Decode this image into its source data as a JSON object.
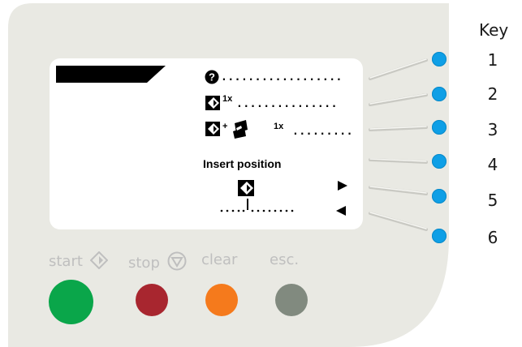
{
  "legend": {
    "title": "Key",
    "numbers": [
      "1",
      "2",
      "3",
      "4",
      "5",
      "6"
    ]
  },
  "display": {
    "multiplier_1": "1x",
    "multiplier_2": "1x",
    "insert_label": "Insert position"
  },
  "buttons": {
    "start_label": "start",
    "stop_label": "stop",
    "clear_label": "clear",
    "esc_label": "esc."
  },
  "colors": {
    "panel": "#e9e9e3",
    "led": "#0f9fe6",
    "start": "#0aa64a",
    "stop": "#a8262f",
    "clear": "#f57a1c",
    "esc": "#818a7f"
  }
}
